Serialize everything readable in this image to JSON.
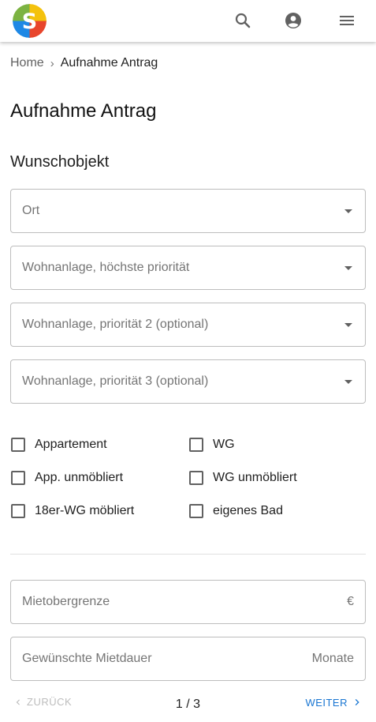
{
  "header": {
    "logo_letter": "S",
    "icons": [
      "search-icon",
      "account-icon",
      "menu-icon"
    ]
  },
  "breadcrumb": {
    "home": "Home",
    "separator": "›",
    "current": "Aufnahme Antrag"
  },
  "page_title": "Aufnahme Antrag",
  "section_title": "Wunschobjekt",
  "selects": [
    {
      "placeholder": "Ort"
    },
    {
      "placeholder": "Wohnanlage, höchste priorität"
    },
    {
      "placeholder": "Wohnanlage, priorität 2 (optional)"
    },
    {
      "placeholder": "Wohnanlage, priorität 3 (optional)"
    }
  ],
  "checkboxes": [
    {
      "label": "Appartement",
      "checked": false
    },
    {
      "label": "WG",
      "checked": false
    },
    {
      "label": "App. unmöbliert",
      "checked": false
    },
    {
      "label": "WG unmöbliert",
      "checked": false
    },
    {
      "label": "18er-WG möbliert",
      "checked": false
    },
    {
      "label": "eigenes Bad",
      "checked": false
    }
  ],
  "inputs": [
    {
      "placeholder": "Mietobergrenze",
      "suffix": "€"
    },
    {
      "placeholder": "Gewünschte Mietdauer",
      "suffix": "Monate"
    }
  ],
  "pager": {
    "back_label": "ZURÜCK",
    "page_indicator": "1 / 3",
    "next_label": "WEITER"
  },
  "colors": {
    "accent": "#1976d2",
    "disabled": "#bdbdbd",
    "outline": "#bdbdbd"
  }
}
